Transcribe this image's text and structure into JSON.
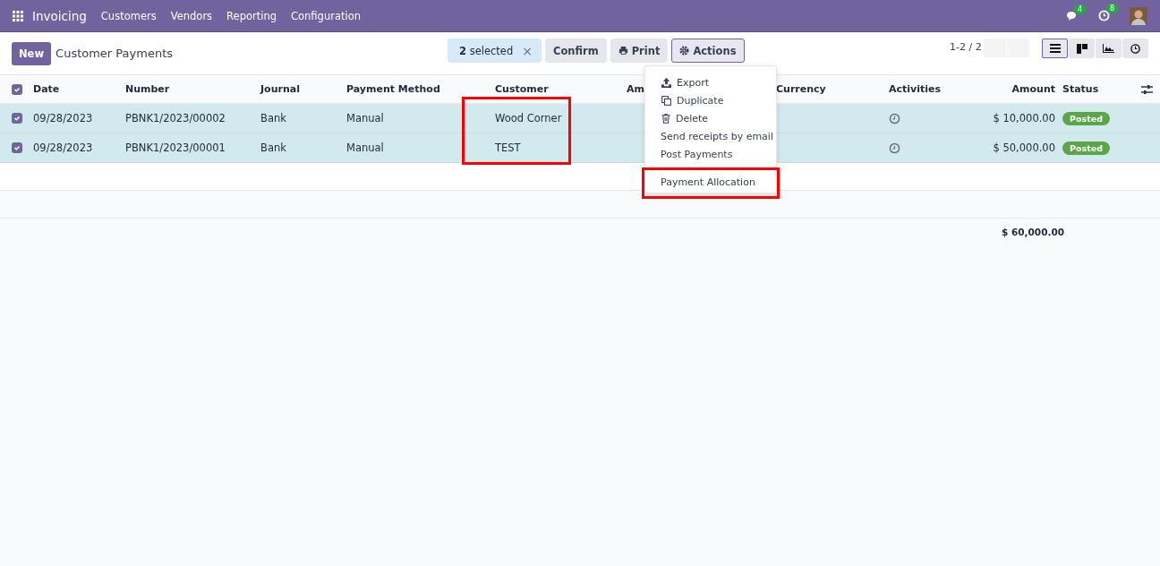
{
  "navbar": {
    "app": "Invoicing",
    "menus": [
      "Customers",
      "Vendors",
      "Reporting",
      "Configuration"
    ],
    "chat_badge": "4",
    "activity_badge": "8"
  },
  "control_panel": {
    "new_button": "New",
    "title": "Customer Payments",
    "selection": "**2** selected",
    "clear": "×",
    "buttons": [
      {
        "kind": "plain",
        "label": "Confirm"
      },
      {
        "kind": "print",
        "label": "Print"
      },
      {
        "kind": "actions",
        "label": "Actions"
      }
    ],
    "pager": "1-2 / 2",
    "views": [
      {
        "kind": "list",
        "selected": true
      },
      {
        "kind": "kanban",
        "selected": false
      },
      {
        "kind": "graph",
        "selected": false
      },
      {
        "kind": "activity",
        "selected": false
      }
    ]
  },
  "table": {
    "all_checked": true,
    "columns": [
      "Date",
      "Number",
      "Journal",
      "Payment Method",
      "Customer",
      "Am",
      "Currency",
      "Activities",
      "Amount",
      "Status"
    ],
    "rows": [
      {
        "checked": true,
        "date": "09/28/2023",
        "number": "PBNK1/2023/00002",
        "journal": "Bank",
        "method": "Manual",
        "customer": "Wood Corner",
        "amount": "$ 10,000.00",
        "status": "Posted"
      },
      {
        "checked": true,
        "date": "09/28/2023",
        "number": "PBNK1/2023/00001",
        "journal": "Bank",
        "method": "Manual",
        "customer": "TEST",
        "amount": "$ 50,000.00",
        "status": "Posted"
      }
    ],
    "total": "$ 60,000.00"
  },
  "actions_menu": [
    {
      "kind": "export",
      "label": "Export"
    },
    {
      "kind": "duplicate",
      "label": "Duplicate"
    },
    {
      "kind": "delete",
      "label": "Delete"
    },
    {
      "kind": "text",
      "label": "Send receipts by email"
    },
    {
      "kind": "text",
      "label": "Post Payments"
    },
    {
      "kind": "text",
      "label": "Payment Allocation"
    }
  ]
}
